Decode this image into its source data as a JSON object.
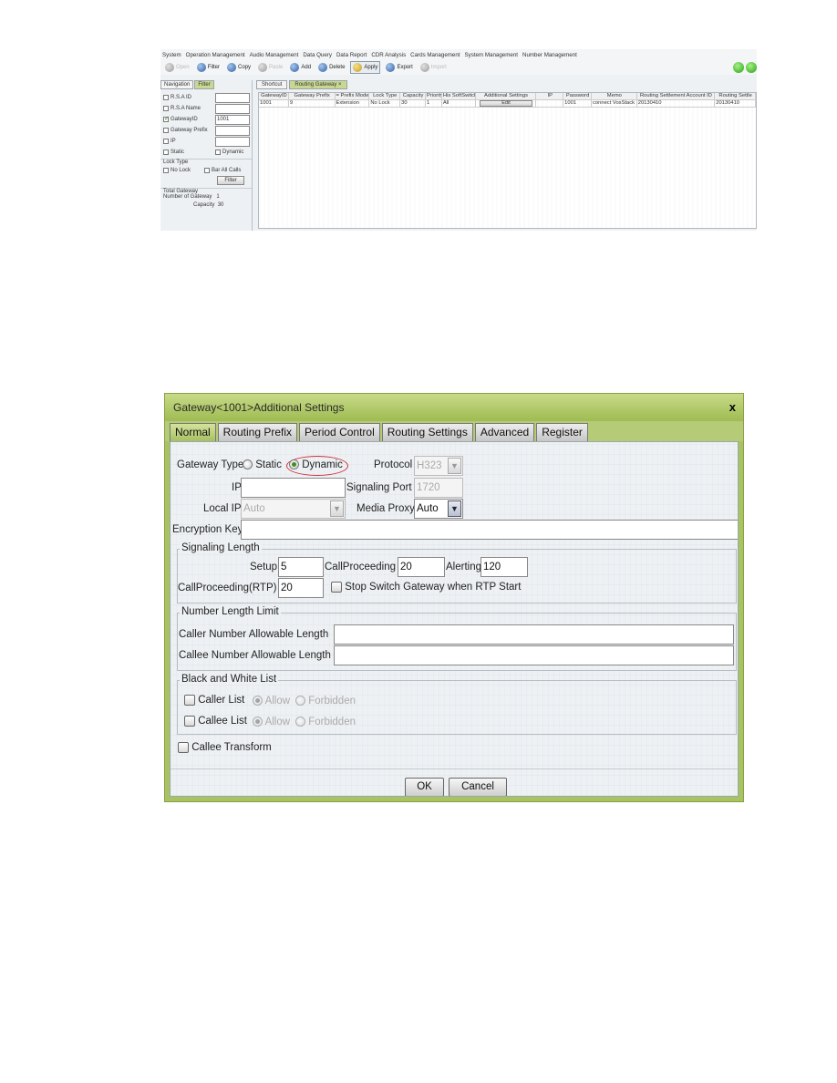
{
  "app": {
    "menu": [
      "System",
      "Operation Management",
      "Audio Management",
      "Data Query",
      "Data Report",
      "CDR Analysis",
      "Cards Management",
      "System Management",
      "Number Management"
    ],
    "toolbar": [
      {
        "label": "Open",
        "icon": "open-icon",
        "state": "disabled"
      },
      {
        "label": "Filter",
        "icon": "filter-icon",
        "state": "enabled"
      },
      {
        "label": "Copy",
        "icon": "copy-icon",
        "state": "enabled"
      },
      {
        "label": "Paste",
        "icon": "paste-icon",
        "state": "disabled"
      },
      {
        "label": "Add",
        "icon": "add-icon",
        "state": "enabled"
      },
      {
        "label": "Delete",
        "icon": "delete-icon",
        "state": "enabled"
      },
      {
        "label": "Apply",
        "icon": "apply-icon",
        "state": "active"
      },
      {
        "label": "Export",
        "icon": "export-icon",
        "state": "enabled"
      },
      {
        "label": "Import",
        "icon": "import-icon",
        "state": "disabled"
      }
    ],
    "status_light_color": "#22a40e",
    "left_tabs": [
      "Navigation",
      "Filter"
    ],
    "filter": {
      "rsa_id": "R.S.A ID",
      "rsa_name": "R.S.A Name",
      "gateway_id": "GatewayID",
      "gateway_id_value": "1001",
      "gateway_prefix": "Gateway Prefix",
      "ip": "IP",
      "static": "Static",
      "dynamic": "Dynamic",
      "lock_type": "Lock Type",
      "no_lock": "No Lock",
      "bar_all_calls": "Bar All Calls",
      "filter_button": "Filter",
      "total_gateway": "Total Gateway",
      "number_of_gateway_label": "Number of Gateway",
      "number_of_gateway_value": "1",
      "capacity_label": "Capacity",
      "capacity_value": "30"
    },
    "content_tabs": [
      "Shortcut",
      "Routing Gateway ×"
    ],
    "grid": {
      "columns": [
        "GatewayID",
        "Gateway Prefix",
        "= Prefix Mode",
        "Lock Type",
        "Capacity",
        "Priority",
        "His SoftSwitch",
        "Additional Settings",
        "IP",
        "Password",
        "Memo",
        "Routing Settlement Account ID",
        "Routing Settle"
      ],
      "rows": [
        [
          "1001",
          "9",
          "Extension",
          "No Lock",
          "30",
          "1",
          "All",
          "Edit",
          "",
          "1001",
          "connect VosStack",
          "20130410",
          "20130410"
        ]
      ]
    }
  },
  "dialog": {
    "title": "Gateway<1001>Additional Settings",
    "close": "x",
    "tabs": [
      "Normal",
      "Routing Prefix",
      "Period Control",
      "Routing Settings",
      "Advanced",
      "Register"
    ],
    "active_tab": "Normal",
    "gateway_type_label": "Gateway Type",
    "gateway_type_options": [
      "Static",
      "Dynamic"
    ],
    "gateway_type_selected": "Dynamic",
    "highlight_color": "#d0303c",
    "protocol_label": "Protocol",
    "protocol_value": "H323",
    "ip_label": "IP",
    "ip_value": "",
    "signaling_port_label": "Signaling Port",
    "signaling_port_value": "1720",
    "local_ip_label": "Local IP",
    "local_ip_value": "Auto",
    "media_proxy_label": "Media Proxy",
    "media_proxy_value": "Auto",
    "encryption_key_label": "Encryption Key",
    "encryption_key_value": "",
    "signaling_length": {
      "legend": "Signaling Length",
      "setup_label": "Setup",
      "setup_value": "5",
      "call_proceeding_label": "CallProceeding",
      "call_proceeding_value": "20",
      "alerting_label": "Alerting",
      "alerting_value": "120",
      "call_proceeding_rtp_label": "CallProceeding(RTP)",
      "call_proceeding_rtp_value": "20",
      "stop_switch_label": "Stop Switch Gateway when RTP Start",
      "stop_switch_checked": false
    },
    "number_length_limit": {
      "legend": "Number Length Limit",
      "caller_label": "Caller Number Allowable Length",
      "caller_value": "",
      "callee_label": "Callee Number Allowable Length",
      "callee_value": ""
    },
    "black_white_list": {
      "legend": "Black and White List",
      "caller_list_label": "Caller List",
      "callee_list_label": "Callee List",
      "allow_label": "Allow",
      "forbidden_label": "Forbidden",
      "caller_selected": "Allow",
      "callee_selected": "Allow"
    },
    "callee_transform_label": "Callee Transform",
    "ok_label": "OK",
    "cancel_label": "Cancel"
  }
}
